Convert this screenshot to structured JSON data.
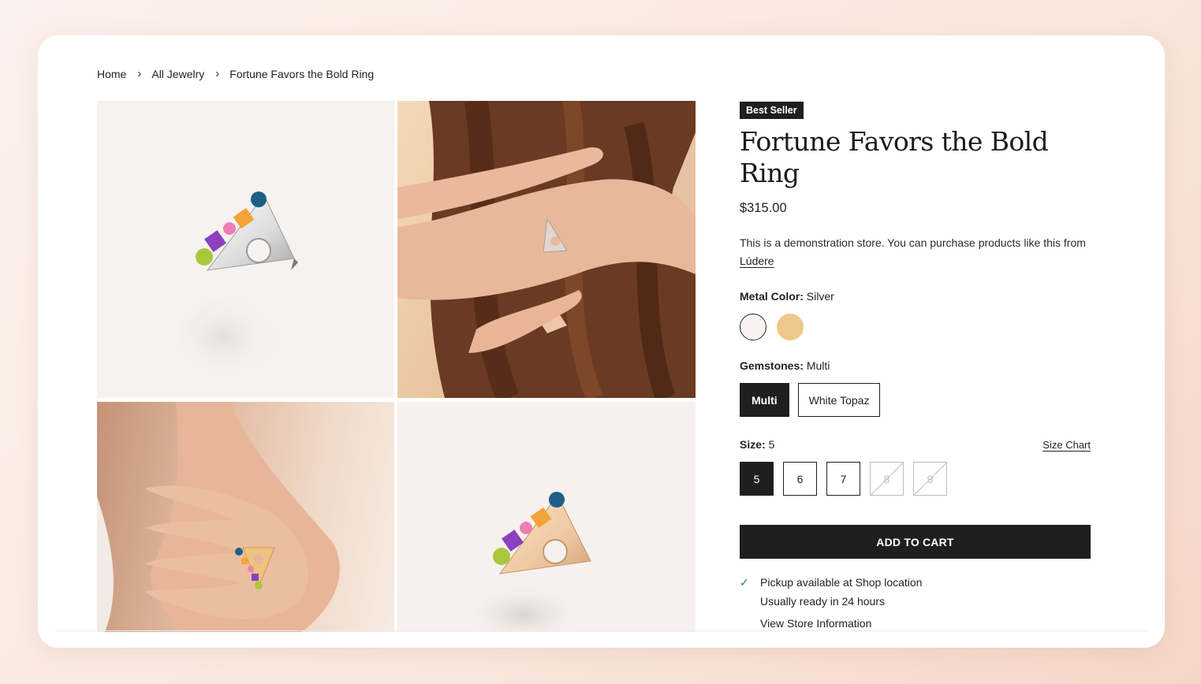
{
  "breadcrumb": {
    "home": "Home",
    "category": "All Jewelry",
    "current": "Fortune Favors the Bold Ring"
  },
  "product": {
    "badge": "Best Seller",
    "title": "Fortune Favors the Bold Ring",
    "price": "$315.00",
    "description": "This is a demonstration store. You can purchase products like this from",
    "vendor_link": "Lúdere"
  },
  "options": {
    "metal": {
      "label": "Metal Color:",
      "selected": "Silver",
      "swatches": [
        {
          "name": "Silver",
          "color": "#f7f2ef"
        },
        {
          "name": "Gold",
          "color": "#f0c78a"
        }
      ]
    },
    "gemstones": {
      "label": "Gemstones:",
      "selected": "Multi",
      "values": [
        "Multi",
        "White Topaz"
      ]
    },
    "size": {
      "label": "Size:",
      "selected": "5",
      "chart_link": "Size Chart",
      "values": [
        "5",
        "6",
        "7",
        "8",
        "9"
      ]
    }
  },
  "cart": {
    "add_label": "ADD TO CART"
  },
  "pickup": {
    "line1": "Pickup available at Shop location",
    "line2": "Usually ready in 24 hours",
    "store_link": "View Store Information"
  },
  "colors": {
    "dark": "#1f1f1f",
    "check_green": "#2b8a3e",
    "gold_swatch": "#f0c78a"
  }
}
